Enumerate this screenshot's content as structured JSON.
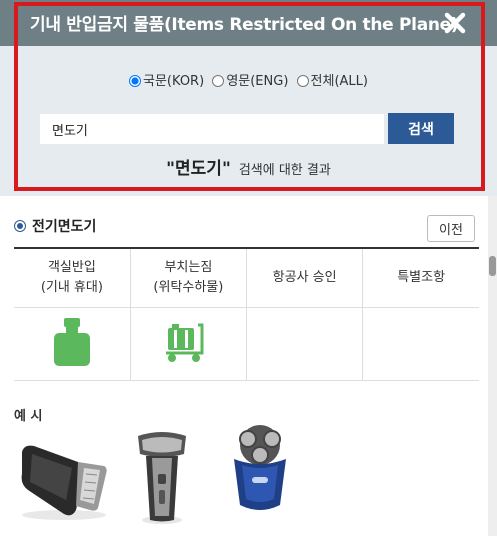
{
  "header": {
    "title": "기내 반입금지 물품(Items Restricted On the Plane)",
    "close_icon": "close-icon"
  },
  "search": {
    "languages": [
      {
        "label": "국문(KOR)",
        "selected": true
      },
      {
        "label": "영문(ENG)",
        "selected": false
      },
      {
        "label": "전체(ALL)",
        "selected": false
      }
    ],
    "input_value": "면도기",
    "button_label": "검색",
    "result_term": "\"면도기\"",
    "result_suffix": "검색에 대한 결과"
  },
  "category": {
    "name": "전기면도기",
    "prev_label": "이전"
  },
  "table": {
    "headers": [
      {
        "line1": "객실반입",
        "line2": "(기내 휴대)"
      },
      {
        "line1": "부치는짐",
        "line2": "(위탁수하물)"
      },
      {
        "line1": "항공사 승인",
        "line2": ""
      },
      {
        "line1": "특별조항",
        "line2": ""
      }
    ],
    "cells": [
      {
        "icon": "carry-on-bag-icon",
        "allowed": true
      },
      {
        "icon": "luggage-cart-icon",
        "allowed": true
      },
      {
        "icon": "",
        "allowed": false
      },
      {
        "icon": "",
        "allowed": false
      }
    ],
    "accent_color": "#5cb85c"
  },
  "examples": {
    "title": "예 시",
    "items": [
      "electric-shaver-image-1",
      "electric-shaver-image-2",
      "electric-shaver-image-3"
    ]
  },
  "colors": {
    "header_bg": "#6e7f86",
    "panel_bg": "#e5ebef",
    "highlight_border": "#d71920",
    "primary_button": "#2b5a97"
  }
}
